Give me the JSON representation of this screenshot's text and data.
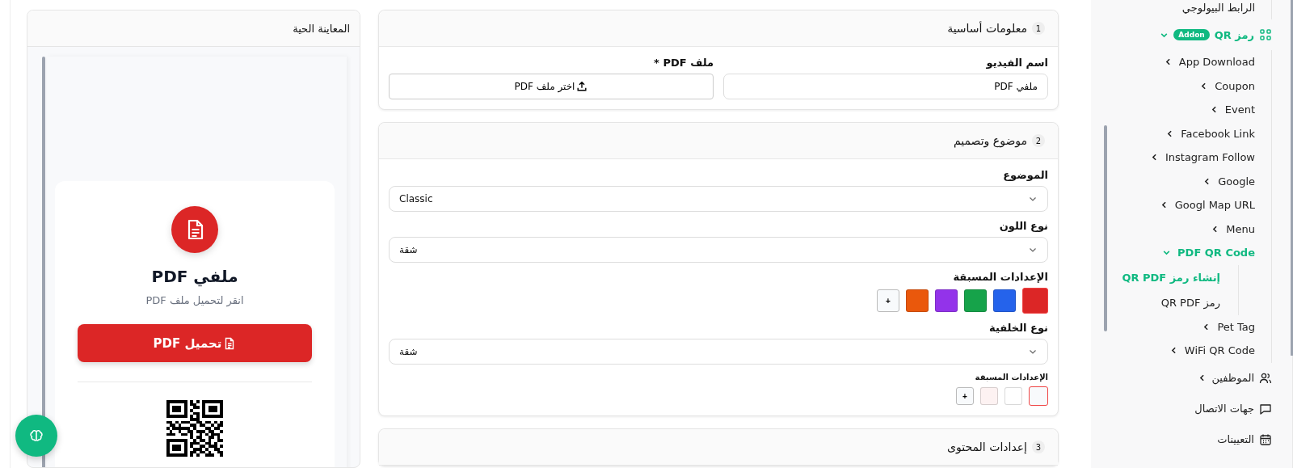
{
  "preview": {
    "title": "المعاينة الحية",
    "card": {
      "title": "ملفي PDF",
      "subtitle": "انقر لتحميل ملف PDF",
      "button": "تحميل PDF"
    }
  },
  "sections": [
    {
      "number": "1",
      "title": "معلومات أساسية",
      "fields": [
        {
          "kind": "text",
          "label": "اسم الفيديو",
          "value": "ملفي PDF"
        },
        {
          "kind": "file",
          "label": "ملف PDF *",
          "button": "اختر ملف PDF"
        }
      ]
    },
    {
      "number": "2",
      "title": "موضوع وتصميم",
      "fields": [
        {
          "kind": "select",
          "label": "الموضوع",
          "value": "Classic"
        },
        {
          "kind": "select",
          "label": "نوع اللون",
          "value": "شقة"
        },
        {
          "kind": "swatches",
          "label": "الإعدادات المسبقة",
          "add": "+",
          "swatches": [
            {
              "color": "#dc2626",
              "selected": true
            },
            {
              "color": "#2563eb",
              "selected": false
            },
            {
              "color": "#16a34a",
              "selected": false
            },
            {
              "color": "#9333ea",
              "selected": false
            },
            {
              "color": "#ea580c",
              "selected": false
            }
          ]
        },
        {
          "kind": "select",
          "label": "نوع الخلفية",
          "value": "شقة"
        },
        {
          "kind": "chips",
          "label": "الإعدادات المسبقة",
          "add": "+",
          "swatches": [
            {
              "color": "#f8fafc",
              "selected": true
            },
            {
              "color": "#ffffff",
              "selected": false
            },
            {
              "color": "#fdf2f2",
              "selected": false
            }
          ]
        }
      ]
    },
    {
      "number": "3",
      "title": "إعدادات المحتوى"
    }
  ],
  "sidebar": {
    "items": [
      {
        "label": "الرابط البيولوجي",
        "kind": "sub",
        "selected": false
      },
      {
        "label": "رمز QR",
        "kind": "group",
        "badge": "Addon",
        "expanded": true,
        "selected": true,
        "children": [
          {
            "label": "App Download",
            "expanded": false,
            "selected": false
          },
          {
            "label": "Coupon",
            "expanded": false,
            "selected": false
          },
          {
            "label": "Event",
            "expanded": false,
            "selected": false
          },
          {
            "label": "Facebook Link",
            "expanded": false,
            "selected": false
          },
          {
            "label": "Instagram Follow",
            "expanded": false,
            "selected": false
          },
          {
            "label": "Google",
            "expanded": false,
            "selected": false
          },
          {
            "label": "Googl Map URL",
            "expanded": false,
            "selected": false
          },
          {
            "label": "Menu",
            "expanded": false,
            "selected": false
          },
          {
            "label": "PDF QR Code",
            "expanded": true,
            "selected": true,
            "children": [
              {
                "label": "إنشاء رمز QR PDF",
                "selected": true
              },
              {
                "label": "رمز QR PDF",
                "selected": false
              }
            ]
          },
          {
            "label": "Pet Tag",
            "expanded": false,
            "selected": false
          },
          {
            "label": "WiFi QR Code",
            "expanded": false,
            "selected": false
          }
        ]
      },
      {
        "label": "الموظفين",
        "kind": "group",
        "expanded": false,
        "selected": false
      },
      {
        "label": "جهات الاتصال",
        "kind": "link",
        "selected": false
      },
      {
        "label": "التعيينات",
        "kind": "link",
        "selected": false
      }
    ]
  }
}
